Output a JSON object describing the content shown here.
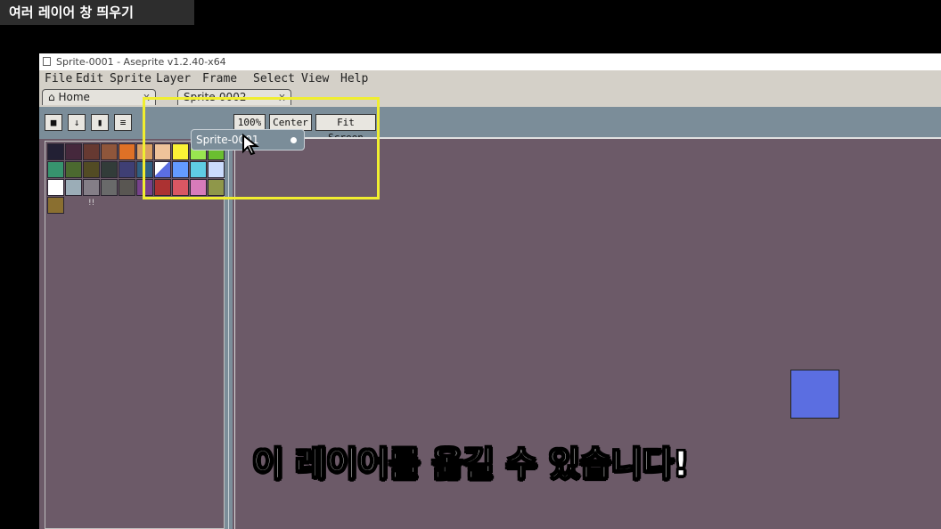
{
  "video_title": "여러 레이어 창 띄우기",
  "window": {
    "title": "Sprite-0001 - Aseprite v1.2.40-x64",
    "menu": [
      "File",
      "Edit",
      "Sprite",
      "Layer",
      "Frame",
      "Select",
      "View",
      "Help"
    ]
  },
  "tabs": [
    {
      "label": "Home",
      "close": "x"
    },
    {
      "label": "Sprite-0002",
      "close": "x"
    }
  ],
  "toolbar": {
    "zoom_label": "100%",
    "center_label": "Center",
    "fit_label": "Fit Screen"
  },
  "palette": {
    "colors": [
      "#222034",
      "#45283c",
      "#663931",
      "#8f563b",
      "#df7126",
      "#d9a066",
      "#eec39a",
      "#fbf236",
      "#99e550",
      "#6abe30",
      "#37946e",
      "#4b692f",
      "#524b24",
      "#323c39",
      "#3f3f74",
      "#306082",
      "#5b6ee1",
      "#639bff",
      "#5fcde4",
      "#cbdbfc",
      "#ffffff",
      "#9badb7",
      "#847e87",
      "#696a6a",
      "#595652",
      "#76428a",
      "#ac3232",
      "#d95763",
      "#d77bba",
      "#8f974a",
      "#8a6f30"
    ],
    "selected_index": 16,
    "count_label": "!!"
  },
  "dragging_tab": {
    "label": "Sprite-0001"
  },
  "subtitle": "이 레이어를 옮길 수 있습니다!",
  "colors": {
    "canvas_bg": "#6c5a68",
    "panel_bg": "#7b8d99",
    "highlight": "#f0ee30",
    "sprite_square": "#5b6ee1"
  }
}
